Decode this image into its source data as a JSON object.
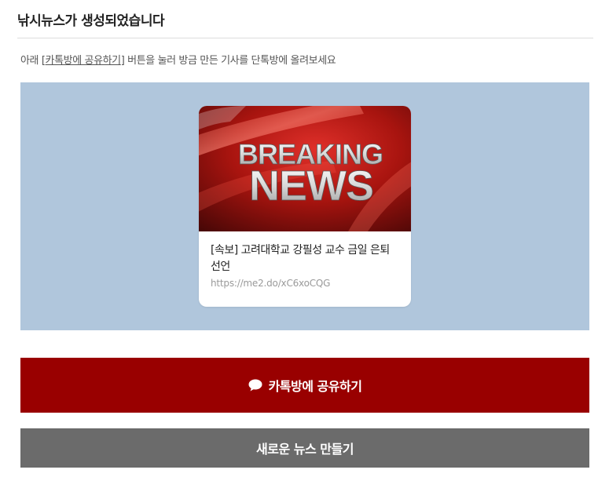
{
  "header": {
    "title": "낚시뉴스가 생성되었습니다"
  },
  "instruction": {
    "prefix": "아래 [",
    "link_label": "카톡방에 공유하기",
    "suffix": "] 버튼을 눌러 방금 만든 기사를 단톡방에 올려보세요"
  },
  "preview_card": {
    "image_text_line1": "BREAKING",
    "image_text_line2": "NEWS",
    "headline": "[속보] 고려대학교 강필성 교수 금일 은퇴 선언",
    "url": "https://me2.do/xC6xoCQG"
  },
  "buttons": {
    "share_label": "카톡방에 공유하기",
    "share_icon": "speech-bubble-icon",
    "new_news_label": "새로운 뉴스 만들기"
  },
  "colors": {
    "preview_background": "#b0c6dc",
    "share_button": "#990000",
    "new_news_button": "#6b6b6b"
  }
}
